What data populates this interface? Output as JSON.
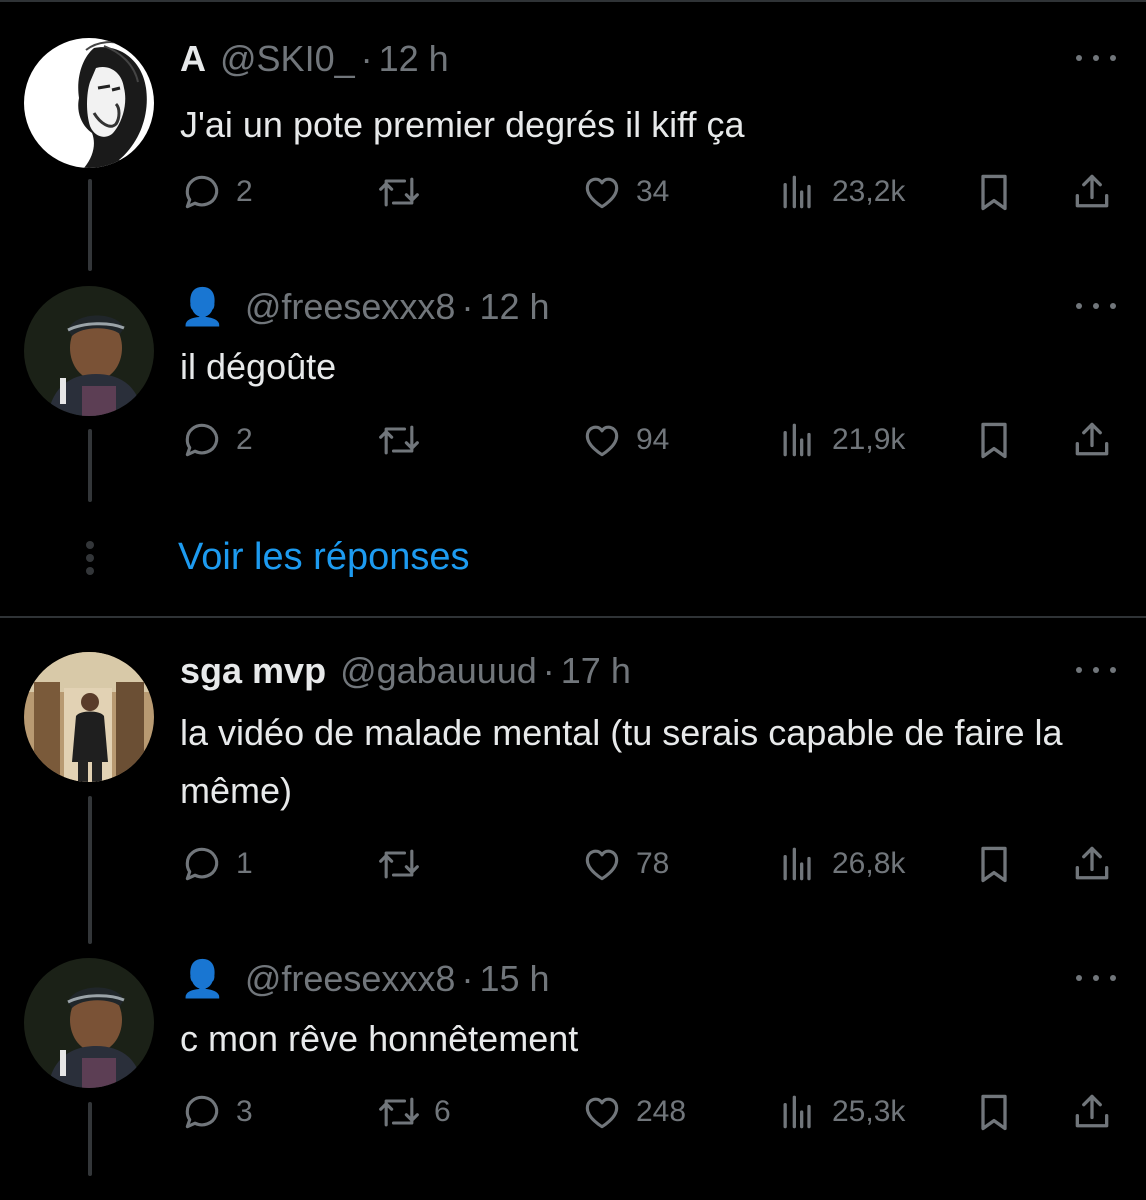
{
  "colors": {
    "background": "#000000",
    "text_primary": "#e7e9ea",
    "text_secondary": "#71767b",
    "link": "#1d9bf0",
    "divider": "#2f3336"
  },
  "icons": {
    "reply": "reply-icon",
    "retweet": "retweet-icon",
    "like": "heart-icon",
    "views": "views-icon",
    "bookmark": "bookmark-icon",
    "share": "share-icon",
    "more": "more-icon"
  },
  "tweets": [
    {
      "display_name": "A",
      "handle": "@SKI0_",
      "separator": "·",
      "time": "12 h",
      "text": "J'ai un pote premier degrés il kiff ça",
      "replies": "2",
      "retweets": "",
      "likes": "34",
      "views": "23,2k"
    },
    {
      "display_name_emoji": "👤",
      "handle": "@freesexxx8",
      "separator": "·",
      "time": "12 h",
      "text": "il dégoûte",
      "replies": "2",
      "retweets": "",
      "likes": "94",
      "views": "21,9k"
    },
    {
      "display_name": "sga mvp",
      "handle": "@gabauuud",
      "separator": "·",
      "time": "17 h",
      "text": "la vidéo de malade mental (tu serais capable de faire la même)",
      "replies": "1",
      "retweets": "",
      "likes": "78",
      "views": "26,8k"
    },
    {
      "display_name_emoji": "👤",
      "handle": "@freesexxx8",
      "separator": "·",
      "time": "15 h",
      "text": "c mon rêve honnêtement",
      "replies": "3",
      "retweets": "6",
      "likes": "248",
      "views": "25,3k"
    }
  ],
  "show_replies": "Voir les réponses"
}
